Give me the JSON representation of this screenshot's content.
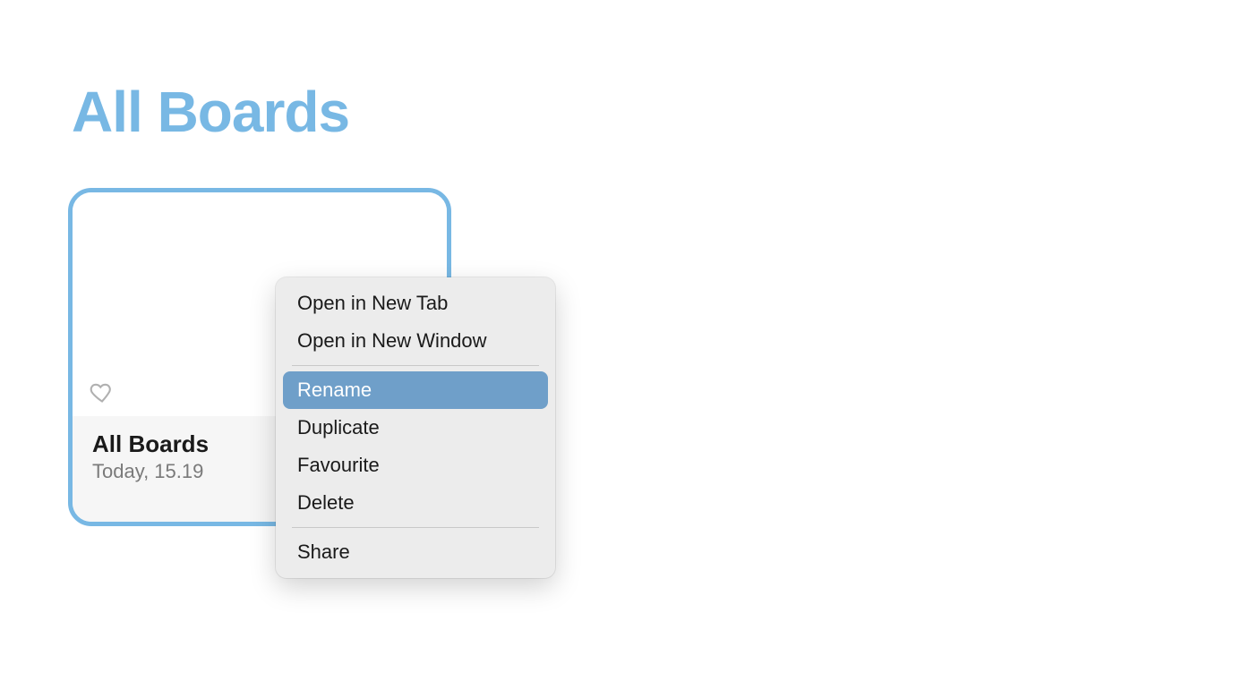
{
  "header": {
    "title": "All Boards"
  },
  "board_card": {
    "title": "All Boards",
    "subtitle": "Today, 15.19"
  },
  "context_menu": {
    "groups": [
      [
        {
          "id": "open-new-tab",
          "label": "Open in New Tab",
          "highlight": false
        },
        {
          "id": "open-new-window",
          "label": "Open in New Window",
          "highlight": false
        }
      ],
      [
        {
          "id": "rename",
          "label": "Rename",
          "highlight": true
        },
        {
          "id": "duplicate",
          "label": "Duplicate",
          "highlight": false
        },
        {
          "id": "favourite",
          "label": "Favourite",
          "highlight": false
        },
        {
          "id": "delete",
          "label": "Delete",
          "highlight": false
        }
      ],
      [
        {
          "id": "share",
          "label": "Share",
          "highlight": false
        }
      ]
    ]
  }
}
